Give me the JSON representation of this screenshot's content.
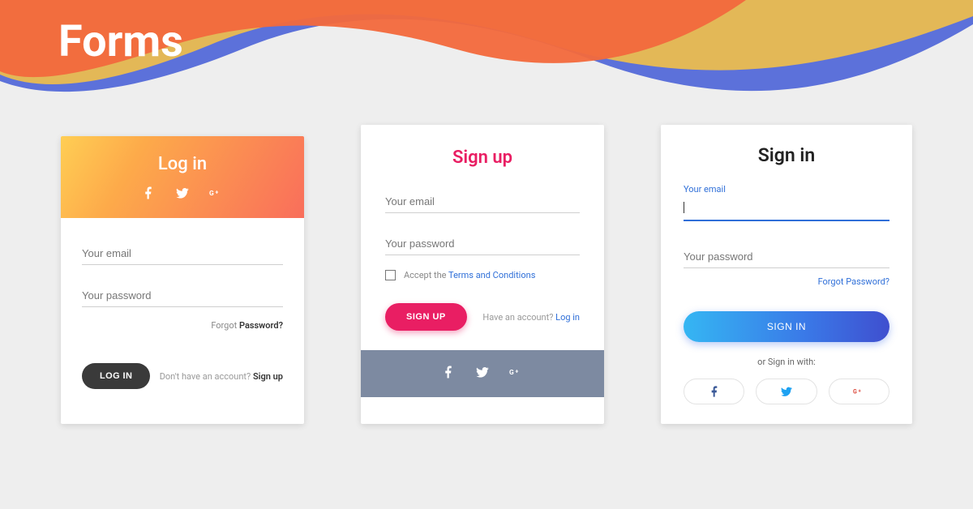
{
  "page_title": "Forms",
  "card1": {
    "title": "Log in",
    "email_placeholder": "Your email",
    "password_placeholder": "Your password",
    "forgot_prefix": "Forgot ",
    "forgot_strong": "Password?",
    "login_btn": "LOG IN",
    "signup_hint_prefix": "Don't have an account? ",
    "signup_hint_strong": "Sign up"
  },
  "card2": {
    "title": "Sign up",
    "email_placeholder": "Your email",
    "password_placeholder": "Your password",
    "accept_prefix": "Accept the ",
    "accept_link": "Terms and Conditions",
    "signup_btn": "SIGN UP",
    "login_hint_prefix": "Have an account? ",
    "login_hint_link": "Log in"
  },
  "card3": {
    "title": "Sign in",
    "email_label": "Your email",
    "password_placeholder": "Your password",
    "forgot": "Forgot Password?",
    "signin_btn": "SIGN IN",
    "or_text": "or Sign in with:"
  }
}
